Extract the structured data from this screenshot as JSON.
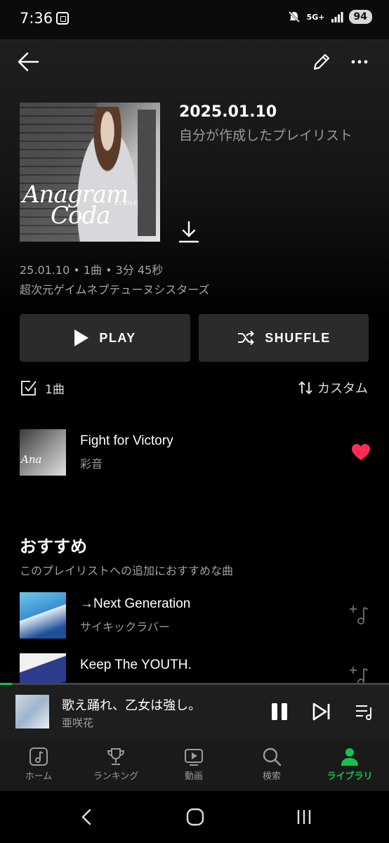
{
  "status_bar": {
    "time": "7:36",
    "network": "5G+",
    "battery": "94",
    "icons": [
      "screenshot-icon",
      "mute-icon",
      "signal-icon"
    ]
  },
  "header": {
    "icons": [
      "back-arrow-icon",
      "pencil-icon",
      "more-horizontal-icon"
    ]
  },
  "playlist": {
    "cover_title_line1": "Anagram",
    "cover_title_line2": "Coda",
    "cover_sub": "AYANE",
    "title": "2025.01.10",
    "subtitle": "自分が作成したプレイリスト",
    "meta": "25.01.10 • 1曲 • 3分 45秒",
    "artist": "超次元ゲイムネプテューヌシスターズ"
  },
  "actions": {
    "play_label": "PLAY",
    "shuffle_label": "SHUFFLE",
    "select_count": "1曲",
    "sort_label": "カスタム"
  },
  "tracks": [
    {
      "title": "Fight for Victory",
      "artist": "彩音",
      "liked": true
    }
  ],
  "recommend": {
    "heading": "おすすめ",
    "subheading": "このプレイリストへの追加におすすめな曲",
    "items": [
      {
        "title": "→Next Generation",
        "artist": "サイキックラバー"
      },
      {
        "title": "Keep The YOUTH.",
        "artist": ""
      }
    ]
  },
  "mini_player": {
    "title": "歌え踊れ、乙女は強し。",
    "artist": "亜咲花",
    "progress": 0.03
  },
  "bottom_nav": {
    "items": [
      {
        "label": "ホーム",
        "icon": "music-note-icon",
        "active": false
      },
      {
        "label": "ランキング",
        "icon": "trophy-icon",
        "active": false
      },
      {
        "label": "動画",
        "icon": "video-play-icon",
        "active": false
      },
      {
        "label": "検索",
        "icon": "search-icon",
        "active": false
      },
      {
        "label": "ライブラリ",
        "icon": "person-icon",
        "active": true
      }
    ]
  },
  "colors": {
    "accent": "#16c24b",
    "heart": "#ff2a55",
    "background": "#000000",
    "button_bg": "#2b2b2b"
  }
}
